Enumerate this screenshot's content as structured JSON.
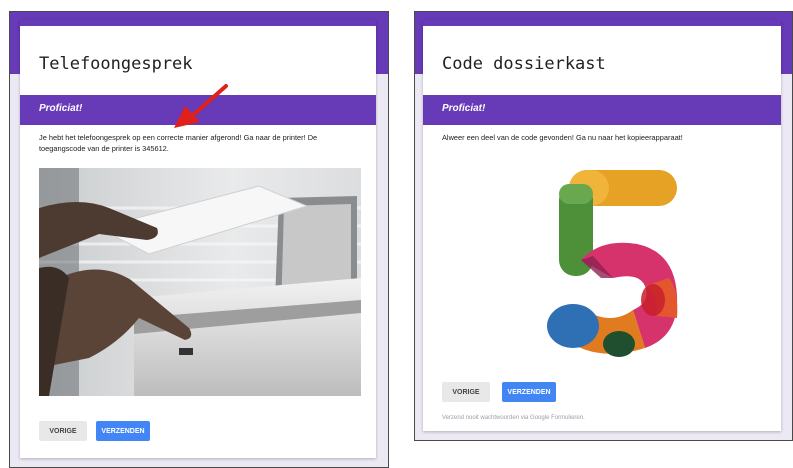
{
  "left_form": {
    "title": "Telefoongesprek",
    "section_title": "Proficiat!",
    "description_line1": "Je hebt het telefoongesprek op een correcte manier afgerond! Ga naar de printer! De",
    "description_line2": "toegangscode van de printer is 345612.",
    "image": "printer-photo",
    "back_label": "VORIGE",
    "submit_label": "VERZENDEN"
  },
  "right_form": {
    "title": "Code dossierkast",
    "section_title": "Proficiat!",
    "description": "Alweer een deel van de code gevonden! Ga nu naar het kopieerapparaat!",
    "image": "number-five-graphic",
    "back_label": "VORIGE",
    "submit_label": "VERZENDEN",
    "footer_note": "Verzend nooit wachtwoorden via Google Formulieren."
  },
  "annotation": {
    "icon": "red-arrow-icon",
    "color": "#e0201b"
  },
  "colors": {
    "theme_purple": "#673ab7",
    "submit_blue": "#4285f4",
    "back_gray": "#e8e8e8"
  }
}
